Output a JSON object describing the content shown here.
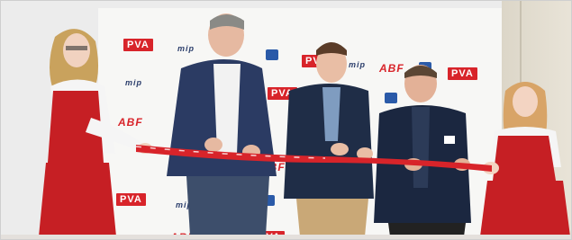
{
  "photo": {
    "description_visible_text": [],
    "backdrop_logos": [
      {
        "kind": "pva",
        "text": "PVA"
      },
      {
        "kind": "abf",
        "text": "ABF"
      },
      {
        "kind": "mip",
        "text": "mip"
      }
    ]
  },
  "colors": {
    "ribbon": "#d8242a",
    "backdrop": "#f7f7f5",
    "hostess_dress": "#c61f24",
    "suit_dark": "#1f2d47"
  }
}
